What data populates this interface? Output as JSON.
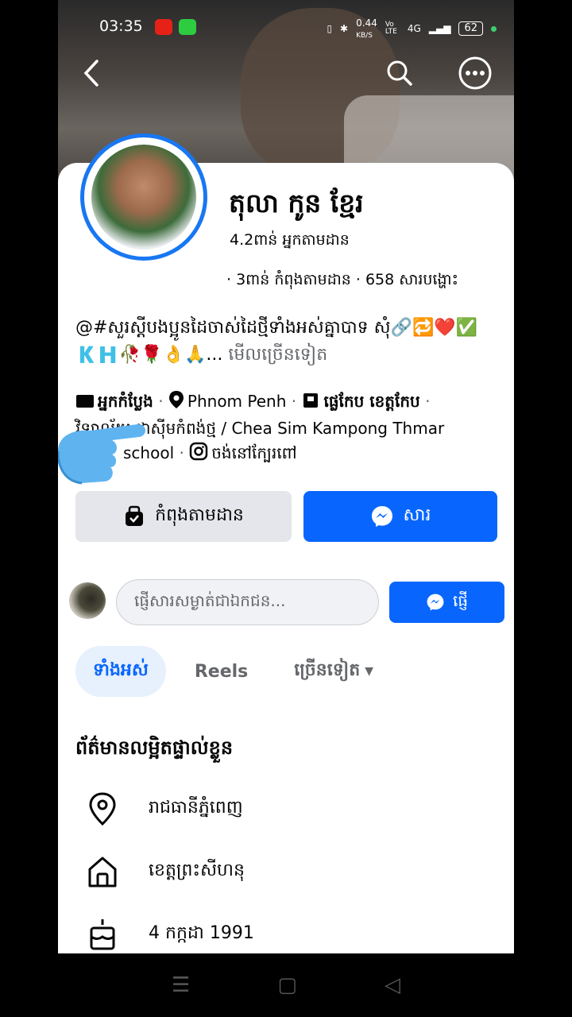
{
  "status_bar": {
    "time": "03:35",
    "speed": "0.44",
    "speed_unit": "KB/S",
    "volte": "Vo LTE",
    "network": "4G",
    "battery": "62"
  },
  "profile": {
    "name": "តុលា កូន ខ្មែរ",
    "followers": "4.2ពាន់ អ្នកតាមដាន",
    "stats": "· 3ពាន់ កំពុងតាមដាន · 658 សារបង្ហោះ",
    "bio_text": "@#សួរស្តីបងប្អូនដៃចាស់ដៃថ្មីទាំងអស់គ្នាបាទ សុំ🔗🔁❤️✅🇰🇭🥀🌹👌🙏...",
    "bio_more": "មើលច្រើនទៀត"
  },
  "intro": {
    "category": "អ្នកកំប្លែង",
    "location": "Phnom Penh",
    "work": "ផ្លេកែប ខេត្តកែប",
    "school_prefix": "វិទ្យាល័យ ជាស៊ីមកំពង់ថ្ម / Chea Sim Kampong Thmar",
    "school_suffix": "school",
    "instagram": "ចង់នៅក្បែរពៅ"
  },
  "actions": {
    "following_label": "កំពុងតាមដាន",
    "message_label": "សារ"
  },
  "composer": {
    "placeholder": "ផ្ញើសារសម្ងាត់ជាឯកជន...",
    "send_label": "ផ្ញើ"
  },
  "tabs": [
    {
      "label": "ទាំងអស់"
    },
    {
      "label": "Reels"
    },
    {
      "label": "ច្រើនទៀត"
    }
  ],
  "details": {
    "title": "ព័ត៌មានលម្អិតផ្ទាល់ខ្លួន",
    "current_city": "រាជធានីភ្នំពេញ",
    "hometown": "ខេត្តព្រះសីហនុ",
    "birthday": "4 កក្កដា 1991"
  },
  "colors": {
    "accent": "#0866ff",
    "button_grey": "#e4e6eb",
    "text_secondary": "#65676b"
  }
}
